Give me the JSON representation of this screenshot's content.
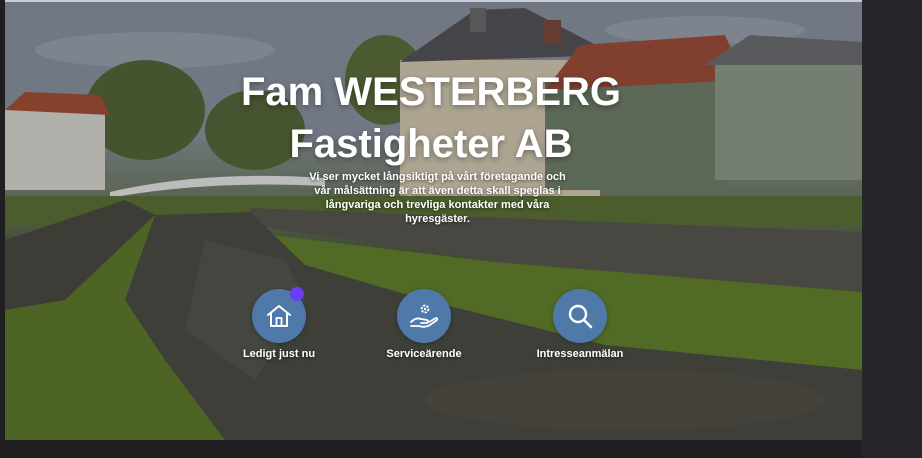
{
  "hero": {
    "title_line1": "Fam WESTERBERG",
    "title_line2": "Fastigheter AB",
    "subtitle": "Vi ser mycket långsiktigt på vårt företagande och vår målsättning är att  även detta skall speglas i långvariga och trevliga kontakter med våra hyresgäster."
  },
  "services": [
    {
      "label": "Ledigt just nu",
      "icon": "house-icon",
      "has_notification": true
    },
    {
      "label": "Serviceärende",
      "icon": "hand-gear-icon"
    },
    {
      "label": "Intresseanmälan",
      "icon": "search-icon"
    }
  ],
  "colors": {
    "service_circle": "#4f79a8",
    "notification_badge": "#6c3df5",
    "text": "#ffffff",
    "page_background": "#1f1f22"
  }
}
